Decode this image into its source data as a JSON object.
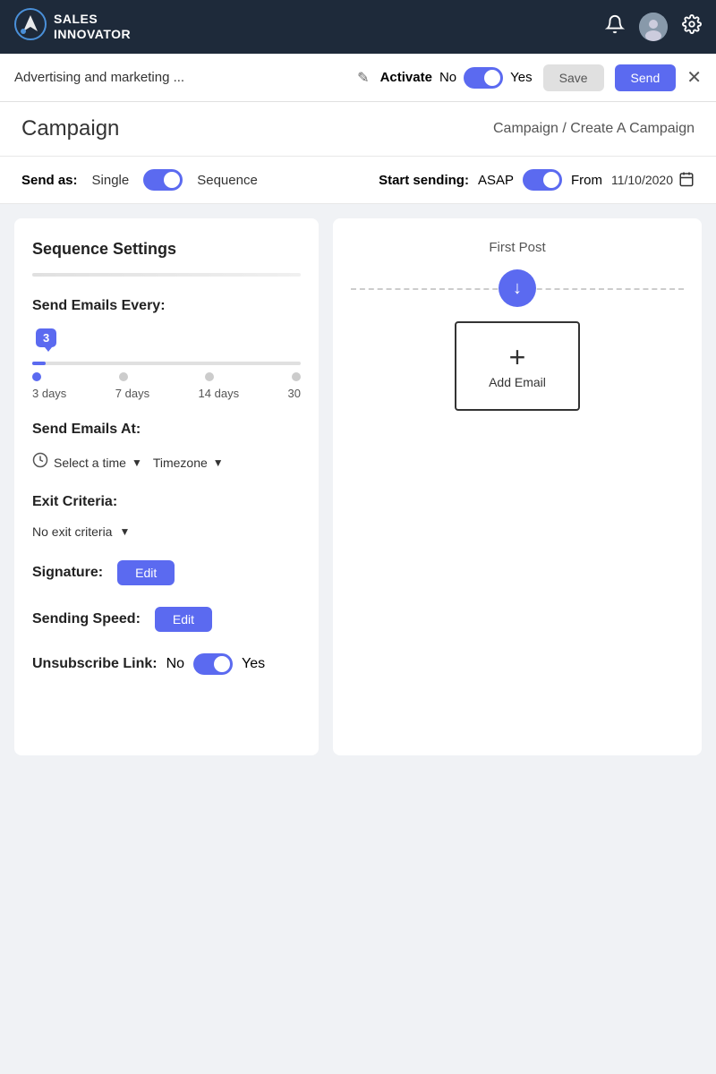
{
  "nav": {
    "logo_line1": "SALES",
    "logo_line2": "INNOVATOR",
    "logo_symbol": "🚀"
  },
  "toolbar": {
    "campaign_name": "Advertising and marketing ...",
    "edit_icon": "✎",
    "activate_label": "Activate",
    "no_label": "No",
    "yes_label": "Yes",
    "save_label": "Save",
    "send_label": "Send",
    "close_label": "✕"
  },
  "page_header": {
    "title": "Campaign",
    "breadcrumb": "Campaign / Create A Campaign"
  },
  "send_as_bar": {
    "label": "Send as:",
    "single": "Single",
    "sequence": "Sequence",
    "start_sending_label": "Start sending:",
    "asap": "ASAP",
    "from_label": "From",
    "date": "11/10/2020",
    "calendar_icon": "📅"
  },
  "sequence_settings": {
    "title": "Sequence Settings",
    "send_emails_every_label": "Send Emails Every:",
    "slider_value": "3",
    "slider_labels": [
      "3 days",
      "7 days",
      "14 days",
      "30"
    ],
    "send_emails_at_label": "Send Emails At:",
    "select_time_label": "Select a time",
    "timezone_label": "Timezone",
    "exit_criteria_label": "Exit Criteria:",
    "no_exit_criteria": "No exit criteria",
    "signature_label": "Signature:",
    "edit_signature_label": "Edit",
    "sending_speed_label": "Sending Speed:",
    "edit_speed_label": "Edit",
    "unsubscribe_label": "Unsubscribe Link:",
    "unsubscribe_no": "No",
    "unsubscribe_yes": "Yes"
  },
  "right_panel": {
    "first_post_label": "First Post",
    "add_email_label": "Add Email",
    "add_email_plus": "+"
  }
}
